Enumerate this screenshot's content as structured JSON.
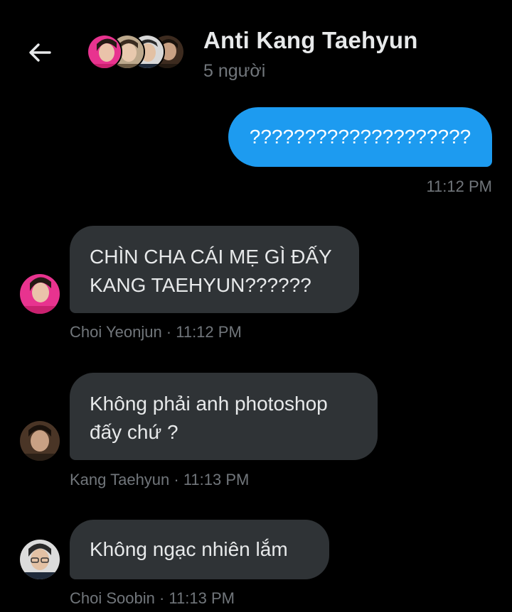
{
  "header": {
    "back_icon": "arrow-left-icon",
    "title": "Anti Kang Taehyun",
    "subtitle": "5 người",
    "avatar_stack": [
      {
        "name": "avatar-pink",
        "bg": "#e8338f"
      },
      {
        "name": "avatar-light",
        "bg": "#c9b9a3"
      },
      {
        "name": "avatar-dark",
        "bg": "#3b3b3b"
      },
      {
        "name": "avatar-brown",
        "bg": "#5c4331"
      }
    ]
  },
  "messages": [
    {
      "direction": "outgoing",
      "text": "????????????????????",
      "time": "11:12 PM"
    },
    {
      "direction": "incoming",
      "lines": [
        "CHÌN CHA CÁI MẸ GÌ ĐẤY",
        "KANG TAEHYUN??????"
      ],
      "sender": "Choi Yeonjun",
      "time": "11:12 PM",
      "meta": "Choi Yeonjun · 11:12 PM"
    },
    {
      "direction": "incoming",
      "lines": [
        "Không phải anh photoshop",
        "đấy chứ ?"
      ],
      "sender": "Kang Taehyun",
      "time": "11:13 PM",
      "meta": "Kang Taehyun · 11:13 PM"
    },
    {
      "direction": "incoming",
      "lines": [
        "Không ngạc nhiên lắm"
      ],
      "sender": "Choi Soobin",
      "time": "11:13 PM",
      "meta": "Choi Soobin · 11:13 PM"
    }
  ],
  "colors": {
    "background": "#000000",
    "outgoing_bubble": "#1d9bf0",
    "incoming_bubble": "#2f3336",
    "secondary_text": "#71767b",
    "primary_text": "#e7e9ea"
  }
}
